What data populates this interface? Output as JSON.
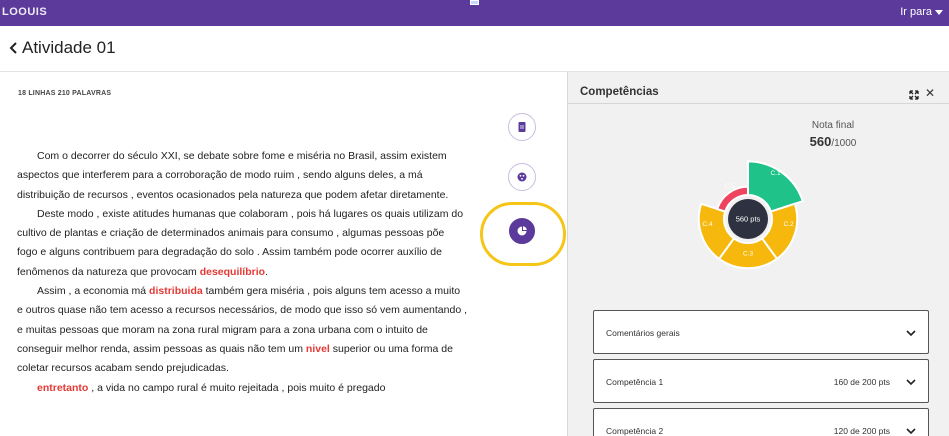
{
  "app": {
    "logo": "LOOUIS",
    "goto_label": "Ir para"
  },
  "header": {
    "title": "Atividade 01"
  },
  "editor": {
    "lines_count": "18 LINHAS",
    "words_count": "210 PALAVRAS",
    "paragraphs": [
      [
        {
          "t": "Com o decorrer do século XXI, se debate sobre fome e miséria no Brasil, assim existem aspectos que interferem para a corroboração de modo ruim , sendo alguns deles, a má distribuição de recursos , eventos ocasionados pela natureza que podem afetar diretamente."
        }
      ],
      [
        {
          "t": "Deste modo , existe atitudes humanas que colaboram , pois há lugares os quais utilizam do cultivo de plantas e criação de determinados animais para consumo , algumas pessoas põe fogo e alguns contribuem para degradação do solo . Assim também pode ocorrer auxílio de fenômenos da natureza que provocam "
        },
        {
          "t": "desequilíbrio",
          "err": true
        },
        {
          "t": "."
        }
      ],
      [
        {
          "t": "Assim , a economia má "
        },
        {
          "t": "distribuida",
          "err": true
        },
        {
          "t": " também gera miséria , pois alguns tem acesso a muito e outros quase não tem acesso a recursos necessários, de modo que isso só vem aumentando , e muitas pessoas que moram na zona rural migram para a zona urbana com o intuito de conseguir melhor renda, assim pessoas as quais não tem um "
        },
        {
          "t": "nivel",
          "err": true
        },
        {
          "t": " superior ou uma forma de coletar recursos acabam sendo prejudicadas."
        }
      ],
      [
        {
          "t": "entretanto",
          "err": true
        },
        {
          "t": " , a vida no campo rural é muito rejeitada , pois muito é pregado"
        }
      ]
    ]
  },
  "tools": [
    {
      "name": "document-tool-button",
      "icon": "document-icon"
    },
    {
      "name": "palette-tool-button",
      "icon": "palette-icon"
    },
    {
      "name": "competencies-tool-button",
      "icon": "pie-chart-icon"
    }
  ],
  "panel": {
    "title": "Competências",
    "score_label": "Nota final",
    "score_value": "560",
    "score_max": "/1000",
    "center_label": "560 pts",
    "competencies": [
      {
        "id": "C.1",
        "score": 160,
        "max": 200,
        "color": "#1fc38a"
      },
      {
        "id": "C.2",
        "score": 120,
        "max": 200,
        "color": "#f6b80d"
      },
      {
        "id": "C.3",
        "score": 120,
        "max": 200,
        "color": "#f6b80d"
      },
      {
        "id": "C.4",
        "score": 120,
        "max": 200,
        "color": "#f6b80d"
      },
      {
        "id": "C.5",
        "score": 40,
        "max": 200,
        "color": "#ee4460"
      }
    ],
    "cards": [
      {
        "label": "Comentários gerais",
        "pts": ""
      },
      {
        "label": "Competência 1",
        "pts": "160 de 200 pts"
      },
      {
        "label": "Competência 2",
        "pts": "120 de 200 pts"
      }
    ]
  },
  "colors": {
    "brand": "#5b3a9b",
    "highlight_ring": "#f5c518",
    "error": "#e53935"
  }
}
